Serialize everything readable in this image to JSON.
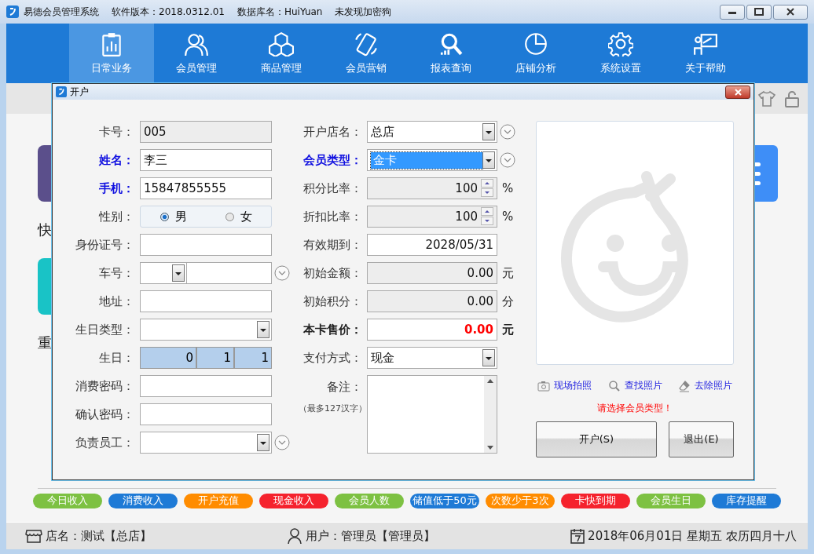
{
  "window": {
    "title": "易德会员管理系统",
    "version": "软件版本：2018.0312.01",
    "database": "数据库名：HuiYuan",
    "dongle": "未发现加密狗"
  },
  "nav": [
    {
      "label": "日常业务",
      "selected": true
    },
    {
      "label": "会员管理",
      "selected": false
    },
    {
      "label": "商品管理",
      "selected": false
    },
    {
      "label": "会员营销",
      "selected": false
    },
    {
      "label": "报表查询",
      "selected": false
    },
    {
      "label": "店铺分析",
      "selected": false
    },
    {
      "label": "系统设置",
      "selected": false
    },
    {
      "label": "关于帮助",
      "selected": false
    }
  ],
  "background": {
    "tile_labels": [
      "快",
      "重"
    ]
  },
  "dialog": {
    "title": "开户",
    "left_fields": [
      {
        "kind": "readonly",
        "label": "卡号：",
        "required": false,
        "strong": false,
        "value": "005"
      },
      {
        "kind": "text",
        "label": "姓名：",
        "required": true,
        "strong": true,
        "value": "李三"
      },
      {
        "kind": "text",
        "label": "手机：",
        "required": true,
        "strong": true,
        "value": "15847855555"
      },
      {
        "kind": "radio",
        "label": "性别：",
        "required": false,
        "strong": false,
        "options": [
          {
            "label": "男",
            "selected": true
          },
          {
            "label": "女",
            "selected": false
          }
        ]
      },
      {
        "kind": "text",
        "label": "身份证号：",
        "required": false,
        "strong": false
      },
      {
        "kind": "split_combo",
        "label": "车号：",
        "required": false,
        "strong": false,
        "picker": true
      },
      {
        "kind": "text",
        "label": "地址：",
        "required": false,
        "strong": false
      },
      {
        "kind": "combo",
        "label": "生日类型：",
        "required": false,
        "strong": false
      },
      {
        "kind": "birthday",
        "label": "生日：",
        "required": false,
        "strong": false,
        "parts": [
          "0",
          "1",
          "1"
        ]
      },
      {
        "kind": "text",
        "label": "消费密码：",
        "required": false,
        "strong": false
      },
      {
        "kind": "text",
        "label": "确认密码：",
        "required": false,
        "strong": false
      },
      {
        "kind": "combo",
        "label": "负责员工：",
        "required": false,
        "strong": false,
        "picker": true
      }
    ],
    "middle_fields": [
      {
        "kind": "combo",
        "label": "开户店名：",
        "required": false,
        "strong": false,
        "value": "总店",
        "picker": true,
        "focused": false
      },
      {
        "kind": "combo",
        "label": "会员类型：",
        "required": true,
        "strong": true,
        "value": "金卡",
        "picker": true,
        "focused": true
      },
      {
        "kind": "spinner",
        "label": "积分比率：",
        "required": false,
        "strong": false,
        "value": "100",
        "unit": "%"
      },
      {
        "kind": "spinner",
        "label": "折扣比率：",
        "required": false,
        "strong": false,
        "value": "100",
        "unit": "%"
      },
      {
        "kind": "date",
        "label": "有效期到：",
        "required": false,
        "strong": false,
        "value": "2028/05/31"
      },
      {
        "kind": "amount",
        "label": "初始金额：",
        "required": false,
        "strong": false,
        "value": "0.00",
        "unit": "元"
      },
      {
        "kind": "amount",
        "label": "初始积分：",
        "required": false,
        "strong": false,
        "value": "0.00",
        "unit": "分"
      },
      {
        "kind": "price",
        "label": "本卡售价：",
        "required": false,
        "strong": true,
        "value": "0.00",
        "unit": "元"
      },
      {
        "kind": "combo",
        "label": "支付方式：",
        "required": false,
        "strong": false,
        "value": "现金",
        "focused": false
      },
      {
        "kind": "memo",
        "label": "备注：",
        "required": false,
        "strong": false,
        "note": "（最多127汉字）"
      }
    ],
    "photo_actions": [
      "现场拍照",
      "查找照片",
      "去除照片"
    ],
    "message": "请选择会员类型！",
    "buttons": [
      "开户(S)",
      "退出(E)"
    ]
  },
  "shortcuts": [
    {
      "label": "今日收入",
      "color": "#7dc142"
    },
    {
      "label": "消费收入",
      "color": "#1e7ad6"
    },
    {
      "label": "开户充值",
      "color": "#ff8c00"
    },
    {
      "label": "现金收入",
      "color": "#f5222d"
    },
    {
      "label": "会员人数",
      "color": "#7dc142"
    },
    {
      "label": "储值低于50元",
      "color": "#1e7ad6"
    },
    {
      "label": "次数少于3次",
      "color": "#ff8c00"
    },
    {
      "label": "卡快到期",
      "color": "#f5222d"
    },
    {
      "label": "会员生日",
      "color": "#7dc142"
    },
    {
      "label": "库存提醒",
      "color": "#1e7ad6"
    }
  ],
  "status_bar": {
    "store": "店名：测试【总店】",
    "user": "用户：管理员【管理员】",
    "date": "2018年06月01日 星期五 农历四月十八"
  }
}
